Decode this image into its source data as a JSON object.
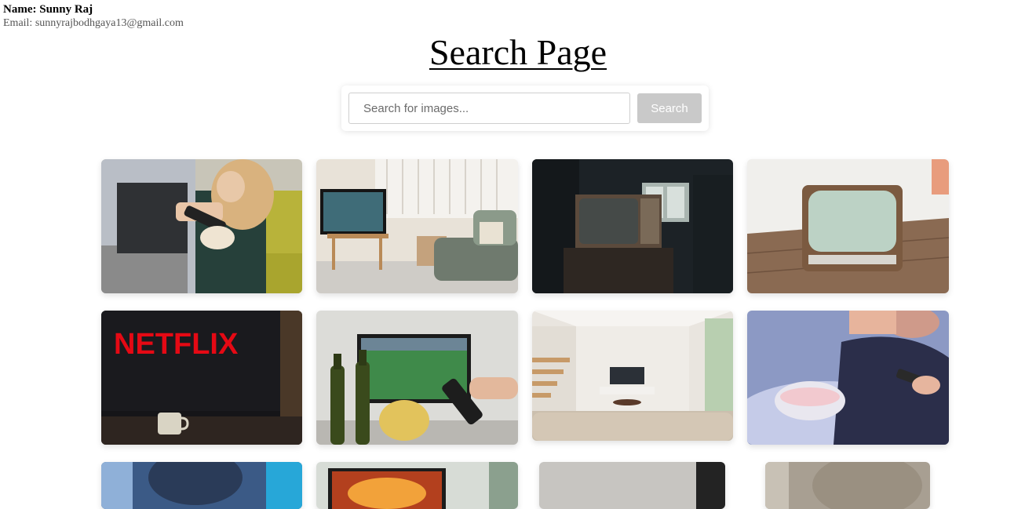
{
  "user": {
    "name_label": "Name: Sunny Raj",
    "email_label": "Email: sunnyrajbodhgaya13@gmail.com"
  },
  "page_title": "Search Page",
  "search": {
    "placeholder": "Search for images...",
    "button_label": "Search"
  },
  "results": [
    {
      "subject": "couple with remote and popcorn on couch"
    },
    {
      "subject": "living room with flat tv on stand"
    },
    {
      "subject": "dark room with old crt tv"
    },
    {
      "subject": "retro tv on wooden floor"
    },
    {
      "subject": "netflix logo on tv with coffee cup",
      "text": "NETFLIX"
    },
    {
      "subject": "football on tv with beer and chips"
    },
    {
      "subject": "minimal living room with tv"
    },
    {
      "subject": "person eating popcorn with remote"
    },
    {
      "subject": "person in blue light"
    },
    {
      "subject": "tv with fire on screen"
    },
    {
      "subject": "grey wall"
    },
    {
      "subject": "blurred beige background"
    }
  ]
}
